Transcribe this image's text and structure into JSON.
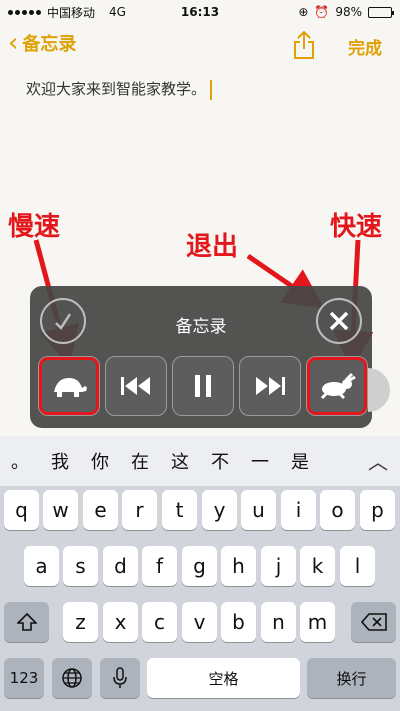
{
  "status": {
    "carrier": "中国移动",
    "network": "4G",
    "time": "16:13",
    "battery": "98%"
  },
  "nav": {
    "back_label": "备忘录",
    "done_label": "完成"
  },
  "note": {
    "text": "欢迎大家来到智能家教学。"
  },
  "annotations": {
    "slow": "慢速",
    "exit": "退出",
    "fast": "快速"
  },
  "hud": {
    "title": "备忘录"
  },
  "candidates": [
    "。",
    "我",
    "你",
    "在",
    "这",
    "不",
    "一",
    "是"
  ],
  "keyboard": {
    "row1": [
      "q",
      "w",
      "e",
      "r",
      "t",
      "y",
      "u",
      "i",
      "o",
      "p"
    ],
    "row2": [
      "a",
      "s",
      "d",
      "f",
      "g",
      "h",
      "j",
      "k",
      "l"
    ],
    "row3": [
      "z",
      "x",
      "c",
      "v",
      "b",
      "n",
      "m"
    ],
    "num_label": "123",
    "space_label": "空格",
    "return_label": "换行"
  },
  "colors": {
    "accent": "#e0a106",
    "annotation": "#e3171b",
    "hud_bg": "#464646"
  }
}
